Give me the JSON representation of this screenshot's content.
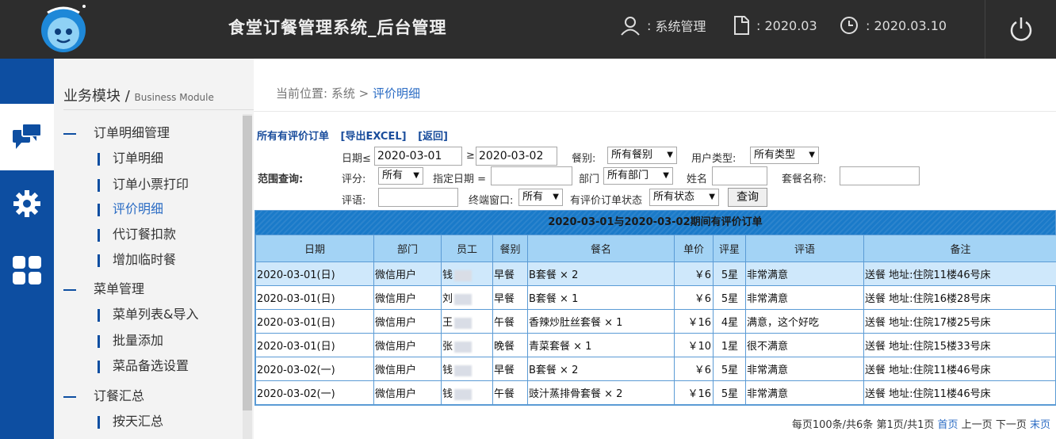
{
  "header": {
    "title": "食堂订餐管理系统_后台管理",
    "user": "系统管理",
    "period": "2020.03",
    "date": "2020.03.10"
  },
  "sidebar": {
    "heading": "业务模块",
    "heading_sub": "Business Module",
    "groups": [
      {
        "label": "订单明细管理",
        "items": [
          "订单明细",
          "订单小票打印",
          "评价明细",
          "代订餐扣款",
          "增加临时餐"
        ]
      },
      {
        "label": "菜单管理",
        "items": [
          "菜单列表&导入",
          "批量添加",
          "菜品备选设置"
        ]
      },
      {
        "label": "订餐汇总",
        "items": [
          "按天汇总"
        ]
      }
    ]
  },
  "breadcrumb": {
    "prefix": "当前位置:",
    "root": "系统",
    "sep": ">",
    "current": "评价明细"
  },
  "actions": {
    "all_orders": "所有有评价订单",
    "export": "[导出EXCEL]",
    "back": "[返回]"
  },
  "filters": {
    "range_label": "范围查询:",
    "date_label": "日期≤",
    "date_from": "2020-03-01",
    "ge": "≥",
    "date_to": "2020-03-02",
    "meal_label": "餐别:",
    "meal_value": "所有餐别",
    "usertype_label": "用户类型:",
    "usertype_value": "所有类型",
    "score_label": "评分:",
    "score_value": "所有",
    "specdate_label": "指定日期 =",
    "dept_label": "部门",
    "dept_value": "所有部门",
    "name_label": "姓名",
    "set_label": "套餐名称:",
    "comment_label": "评语:",
    "terminal_label": "终端窗口:",
    "terminal_value": "所有",
    "status_label": "有评价订单状态",
    "status_value": "所有状态",
    "query_button": "查询"
  },
  "table": {
    "caption": "2020-03-01与2020-03-02期间有评价订单",
    "headers": [
      "日期",
      "部门",
      "员工",
      "餐别",
      "餐名",
      "单价",
      "评星",
      "评语",
      "备注"
    ],
    "rows": [
      {
        "date": "2020-03-01(日)",
        "dept": "微信用户",
        "staff": "钱",
        "meal": "早餐",
        "dish": "B套餐 × 2",
        "price": "￥6",
        "stars": "5星",
        "comment": "非常满意",
        "note": "送餐 地址:住院11楼46号床"
      },
      {
        "date": "2020-03-01(日)",
        "dept": "微信用户",
        "staff": "刘",
        "meal": "早餐",
        "dish": "B套餐 × 1",
        "price": "￥6",
        "stars": "5星",
        "comment": "非常满意",
        "note": "送餐 地址:住院16楼28号床"
      },
      {
        "date": "2020-03-01(日)",
        "dept": "微信用户",
        "staff": "王",
        "meal": "午餐",
        "dish": "香辣炒肚丝套餐 × 1",
        "price": "￥16",
        "stars": "4星",
        "comment": "满意，这个好吃",
        "note": "送餐 地址:住院17楼25号床"
      },
      {
        "date": "2020-03-01(日)",
        "dept": "微信用户",
        "staff": "张",
        "meal": "晚餐",
        "dish": "青菜套餐 × 1",
        "price": "￥10",
        "stars": "1星",
        "comment": "很不满意",
        "note": "送餐 地址:住院15楼33号床"
      },
      {
        "date": "2020-03-02(一)",
        "dept": "微信用户",
        "staff": "钱",
        "meal": "早餐",
        "dish": "B套餐 × 2",
        "price": "￥6",
        "stars": "5星",
        "comment": "非常满意",
        "note": "送餐 地址:住院11楼46号床"
      },
      {
        "date": "2020-03-02(一)",
        "dept": "微信用户",
        "staff": "钱",
        "meal": "午餐",
        "dish": "豉汁蒸排骨套餐 × 2",
        "price": "￥16",
        "stars": "5星",
        "comment": "非常满意",
        "note": "送餐 地址:住院11楼46号床"
      }
    ]
  },
  "pager": {
    "summary": "每页100条/共6条 第1页/共1页",
    "first": "首页",
    "prev": "上一页",
    "next": "下一页",
    "last": "末页"
  }
}
